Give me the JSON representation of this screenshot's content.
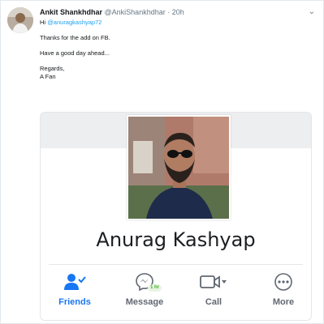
{
  "tweet": {
    "author_name": "Ankit Shankhdhar",
    "handle": "@AnkiShankhdhar",
    "separator": "·",
    "timestamp": "20h",
    "greeting": "Hi",
    "mention": "@anuragkashyap72",
    "line1": "Thanks for the add on FB.",
    "line2": "Have a good day ahead...",
    "line3": "Regards,",
    "line4": "A Fan"
  },
  "facebook_card": {
    "profile_name": "Anurag Kashyap",
    "actions": [
      {
        "label": "Friends",
        "icon": "friends-check-icon"
      },
      {
        "label": "Message",
        "icon": "messenger-icon",
        "badge": "1 hr"
      },
      {
        "label": "Call",
        "icon": "video-call-icon"
      },
      {
        "label": "More",
        "icon": "more-icon"
      }
    ]
  },
  "colors": {
    "twitter_blue": "#1da1f2",
    "facebook_blue": "#1877f2",
    "online_green": "#42b72a"
  }
}
